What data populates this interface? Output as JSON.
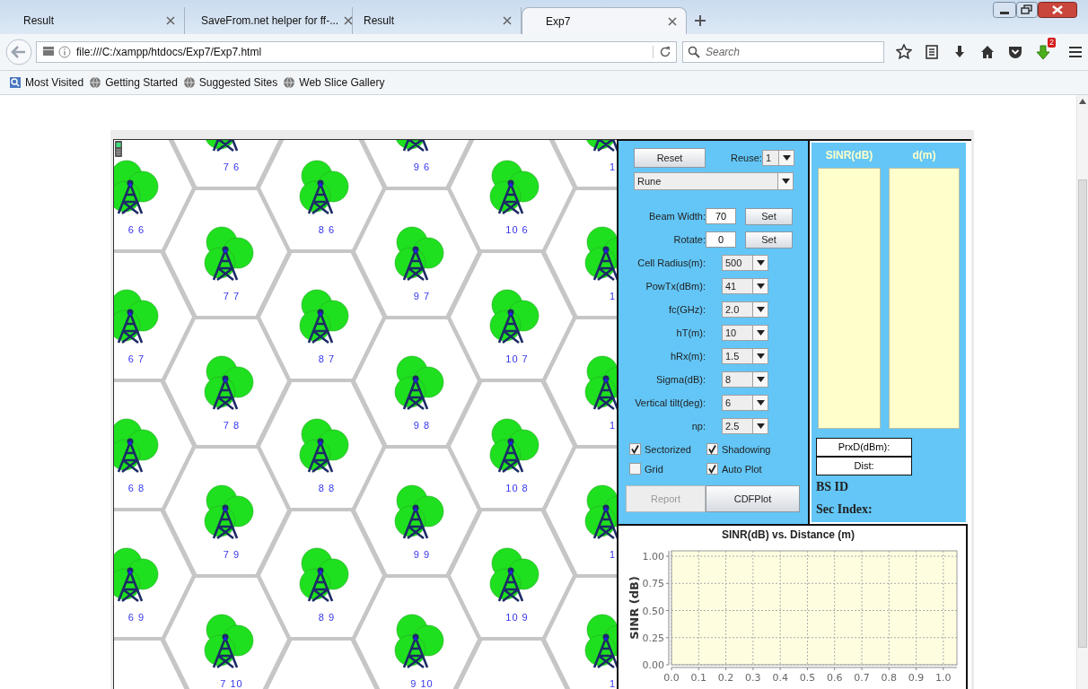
{
  "browser": {
    "tabs": [
      {
        "title": "Result",
        "kind": "plain",
        "selected": false
      },
      {
        "title": "SaveFrom.net helper for ff-...",
        "kind": "download",
        "selected": false
      },
      {
        "title": "Result",
        "kind": "plain",
        "selected": false
      },
      {
        "title": "Exp7",
        "kind": "plain",
        "selected": true
      }
    ],
    "url": "file:///C:/xampp/htdocs/Exp7/Exp7.html",
    "search": {
      "placeholder": "Search"
    },
    "badge": "2",
    "bookmarks": [
      "Most Visited",
      "Getting Started",
      "Suggested Sites",
      "Web Slice Gallery"
    ]
  },
  "map": {
    "columns": [
      [
        "6 6",
        "6 7",
        "6 8",
        "6 9"
      ],
      [
        "7 6",
        "7 7",
        "7 8",
        "7 9",
        "7 10"
      ],
      [
        "8 6",
        "8 7",
        "8 8",
        "8 9"
      ],
      [
        "9 6",
        "9 7",
        "9 8",
        "9 9",
        "9 10"
      ],
      [
        "10 6",
        "10 7",
        "10 8",
        "10 9"
      ],
      [
        "1",
        "1",
        "1",
        "1",
        "1"
      ]
    ]
  },
  "controls": {
    "reset": "Reset",
    "reuse": {
      "label": "Reuse:",
      "value": "1"
    },
    "scheme": "Rune",
    "inputs": [
      {
        "label": "Beam Width:",
        "value": "70",
        "button": "Set"
      },
      {
        "label": "Rotate:",
        "value": "0",
        "button": "Set"
      }
    ],
    "selects": [
      {
        "label": "Cell Radius(m):",
        "value": "500"
      },
      {
        "label": "PowTx(dBm):",
        "value": "41"
      },
      {
        "label": "fc(GHz):",
        "value": "2.0"
      },
      {
        "label": "hT(m):",
        "value": "10"
      },
      {
        "label": "hRx(m):",
        "value": "1.5"
      },
      {
        "label": "Sigma(dB):",
        "value": "8"
      },
      {
        "label": "Vertical tilt(deg):",
        "value": "6"
      },
      {
        "label": "np:",
        "value": "2.5"
      }
    ],
    "checks": [
      {
        "label": "Sectorized",
        "checked": true
      },
      {
        "label": "Shadowing",
        "checked": true
      },
      {
        "label": "Grid",
        "checked": false
      },
      {
        "label": "Auto Plot",
        "checked": true
      }
    ],
    "buttons": [
      {
        "label": "Report",
        "disabled": true
      },
      {
        "label": "CDFPlot",
        "disabled": false
      }
    ]
  },
  "results": {
    "columns": [
      "SINR(dB)",
      "d(m)"
    ],
    "fields": [
      "PrxD(dBm):",
      "Dist:"
    ],
    "bs_id": "BS ID",
    "sec_index": "Sec Index:"
  },
  "chart_data": {
    "type": "line",
    "grid": true,
    "title": "SINR(dB) vs. Distance (m)",
    "ylabel": "SINR (dB)",
    "xlim": [
      0,
      1.05
    ],
    "ylim": [
      0,
      1.05
    ],
    "xticks": [
      {
        "value": 0,
        "label": "0.0"
      },
      {
        "value": 0.1,
        "label": "0.1"
      },
      {
        "value": 0.2,
        "label": "0.2"
      },
      {
        "value": 0.3,
        "label": "0.3"
      },
      {
        "value": 0.4,
        "label": "0.4"
      },
      {
        "value": 0.5,
        "label": "0.5"
      },
      {
        "value": 0.6,
        "label": "0.6"
      },
      {
        "value": 0.7,
        "label": "0.7"
      },
      {
        "value": 0.8,
        "label": "0.8"
      },
      {
        "value": 0.9,
        "label": "0.9"
      },
      {
        "value": 1,
        "label": "1.0"
      }
    ],
    "yticks": [
      {
        "value": 0,
        "label": "0.00"
      },
      {
        "value": 0.25,
        "label": "0.25"
      },
      {
        "value": 0.5,
        "label": "0.50"
      },
      {
        "value": 0.75,
        "label": "0.75"
      },
      {
        "value": 1,
        "label": "1.00"
      }
    ]
  }
}
